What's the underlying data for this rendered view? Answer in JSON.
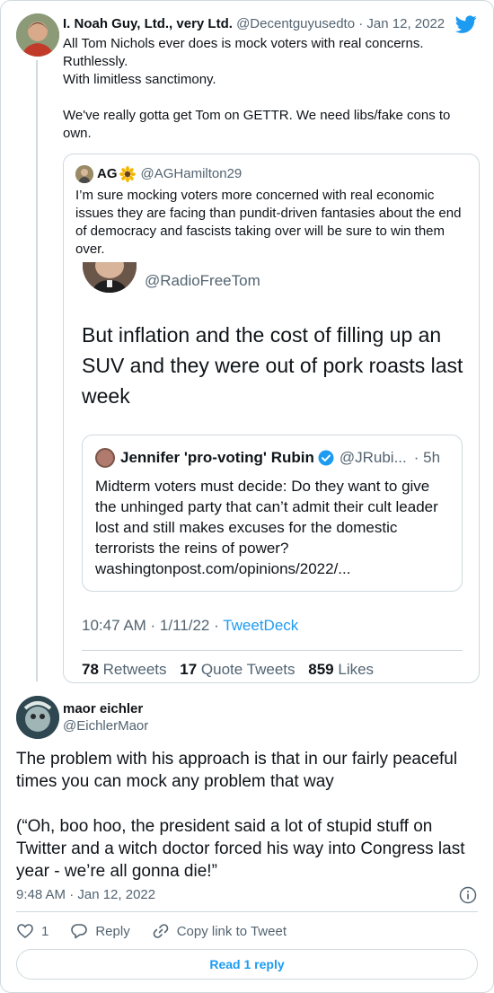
{
  "parent_tweet": {
    "name": "I. Noah Guy, Ltd., very Ltd.",
    "handle": "@Decentguyusedto",
    "date": "Jan 12, 2022",
    "text": "All Tom Nichols ever does is mock voters with real concerns.\nRuthlessly.\nWith limitless sanctimony.\n\nWe've really gotta get Tom on GETTR. We need libs/fake cons to own."
  },
  "quoted_tweet": {
    "name": "AG",
    "handle": "@AGHamilton29",
    "text": "I’m sure mocking voters more concerned with real economic issues they are facing than pundit-driven fantasies about the end of democracy and fascists taking over will be sure to win them over.",
    "screenshot": {
      "handle": "@RadioFreeTom",
      "text": "But inflation and the cost of filling up an SUV and they were out of pork roasts last week",
      "inner_quote": {
        "name": "Jennifer 'pro-voting' Rubin",
        "handle": "@JRubi...",
        "age": "· 5h",
        "text": "Midterm voters must decide: Do they want to give the unhinged party that can’t admit their cult leader lost and still makes excuses for the domestic terrorists the reins of power? washingtonpost.com/opinions/2022/..."
      },
      "time": "10:47 AM · 1/11/22 · ",
      "source": "TweetDeck",
      "retweets": "78",
      "retweets_label": "Retweets",
      "quote_tweets": "17",
      "quote_tweets_label": "Quote Tweets",
      "likes": "859",
      "likes_label": "Likes"
    }
  },
  "reply_tweet": {
    "name": "maor eichler",
    "handle": "@EichlerMaor",
    "text": "The problem with his approach is that in our fairly peaceful times you can mock any problem that way\n\n(“Oh, boo hoo, the president said a lot of stupid stuff on Twitter and a witch doctor forced his way into Congress last year - we’re all gonna die!”",
    "time": "9:48 AM · Jan 12, 2022",
    "like_count": "1",
    "reply_label": "Reply",
    "copy_label": "Copy link to Tweet",
    "read_reply_label": "Read 1 reply"
  },
  "colors": {
    "accent": "#1d9bf0",
    "muted": "#536471",
    "border": "#cfd9de",
    "text": "#0f1419"
  }
}
